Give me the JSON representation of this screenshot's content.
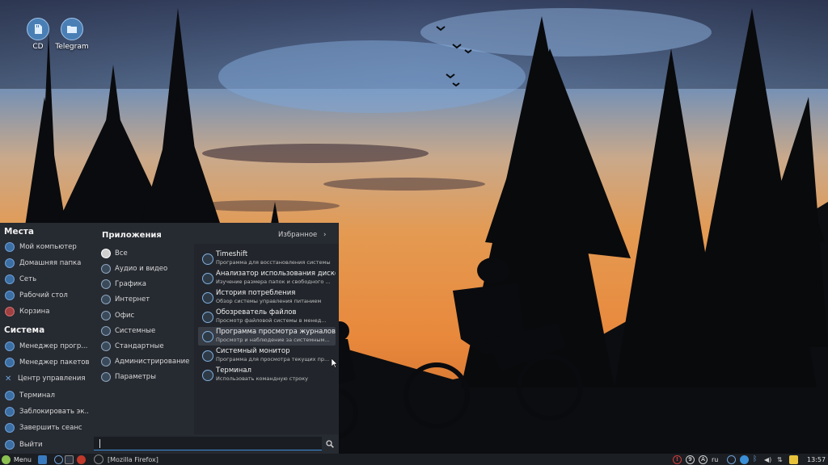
{
  "desktop": {
    "icons": [
      {
        "label": "CD"
      },
      {
        "label": "Telegram"
      }
    ]
  },
  "menu": {
    "places_title": "Места",
    "places": [
      {
        "label": "Мой компьютер"
      },
      {
        "label": "Домашняя папка"
      },
      {
        "label": "Сеть"
      },
      {
        "label": "Рабочий стол"
      },
      {
        "label": "Корзина"
      }
    ],
    "system_title": "Система",
    "system": [
      {
        "label": "Менеджер прогр..."
      },
      {
        "label": "Менеджер пакетов"
      },
      {
        "label": "Центр управления"
      },
      {
        "label": "Терминал"
      },
      {
        "label": "Заблокировать эк..."
      },
      {
        "label": "Завершить сеанс"
      },
      {
        "label": "Выйти"
      }
    ],
    "apps_title": "Приложения",
    "favorites_label": "Избранное",
    "favorites_arrow": "›",
    "categories": [
      {
        "label": "Все"
      },
      {
        "label": "Аудио и видео"
      },
      {
        "label": "Графика"
      },
      {
        "label": "Интернет"
      },
      {
        "label": "Офис"
      },
      {
        "label": "Системные"
      },
      {
        "label": "Стандартные"
      },
      {
        "label": "Администрирование"
      },
      {
        "label": "Параметры"
      }
    ],
    "apps": [
      {
        "name": "Timeshift",
        "desc": "Программа для восстановления системы"
      },
      {
        "name": "Анализатор использования дисков",
        "desc": "Изучение размера папок и свободного ..."
      },
      {
        "name": "История потребления",
        "desc": "Обзор системы управления питанием"
      },
      {
        "name": "Обозреватель файлов",
        "desc": "Просмотр файловой системы в менед..."
      },
      {
        "name": "Программа просмотра журналов",
        "desc": "Просмотр и наблюдение за системным..."
      },
      {
        "name": "Системный монитор",
        "desc": "Программа для просмотра текущих пр..."
      },
      {
        "name": "Терминал",
        "desc": "Использовать командную строку"
      }
    ],
    "search": {
      "value": "",
      "placeholder": ""
    }
  },
  "taskbar": {
    "menu_label": "Menu",
    "window_title": "[Mozilla Firefox]",
    "tray": {
      "updates_count": "9",
      "a_label": "A",
      "keyboard_layout": "ru"
    },
    "clock": "13:57"
  },
  "colors": {
    "menu_bg": "#262a31",
    "apps_panel_bg": "#22262c",
    "accent_blue": "#3b8fd6",
    "taskbar_bg": "#1b1e23",
    "notification_yellow": "#e8c33a",
    "alert_red": "#d23b3b"
  }
}
